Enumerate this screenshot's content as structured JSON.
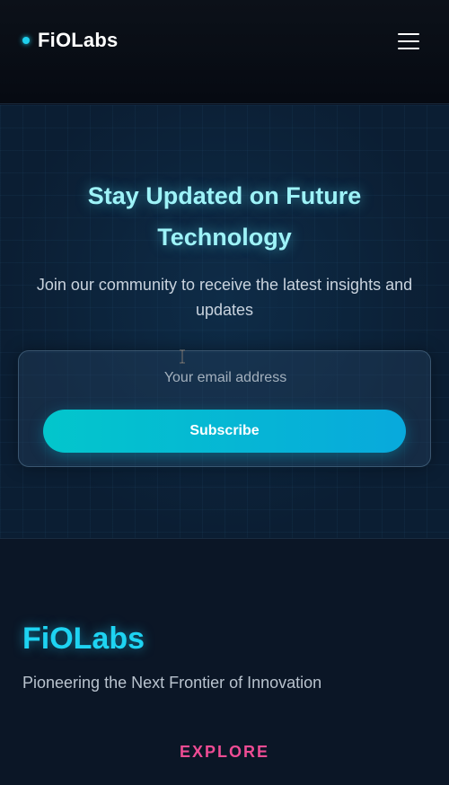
{
  "header": {
    "logo_text": "FiOLabs",
    "menu_icon": "hamburger-icon"
  },
  "newsletter": {
    "title": "Stay Updated on Future Technology",
    "subtitle": "Join our community to receive the latest insights and updates",
    "email_placeholder": "Your email address",
    "email_value": "",
    "subscribe_label": "Subscribe"
  },
  "footer": {
    "brand": "FiOLabs",
    "tagline": "Pioneering the Next Frontier of Innovation",
    "explore_label": "EXPLORE"
  },
  "colors": {
    "accent_cyan": "#1ed3f2",
    "title_glow": "#9ef3f8",
    "button_gradient_start": "#03c6cc",
    "button_gradient_end": "#08a9dc",
    "explore_pink": "#ee4c94",
    "background": "#0b1526"
  }
}
